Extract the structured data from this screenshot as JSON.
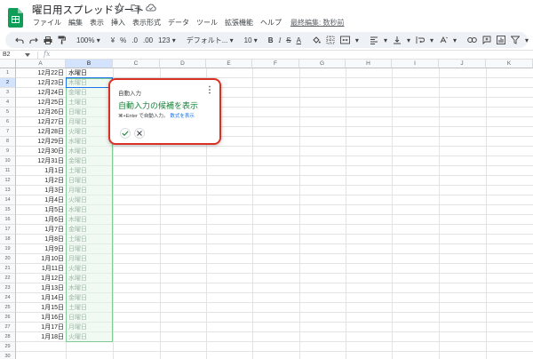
{
  "header": {
    "title": "曜日用スプレッドシート",
    "menus": [
      "ファイル",
      "編集",
      "表示",
      "挿入",
      "表示形式",
      "データ",
      "ツール",
      "拡張機能",
      "ヘルプ"
    ],
    "last_edit": "最終編集: 数秒前"
  },
  "toolbar": {
    "zoom": "100%",
    "currency": "¥",
    "percent": "%",
    "dec_less": ".0",
    "dec_more": ".00",
    "number_format": "123",
    "font": "デフォルト...",
    "font_size": "10",
    "bold": "B",
    "italic": "I",
    "strike": "S",
    "text_color": "A"
  },
  "formula_bar": {
    "cell_ref": "B2",
    "fx": "fx"
  },
  "grid": {
    "columns": [
      "A",
      "B",
      "C",
      "D",
      "E",
      "F",
      "G",
      "H",
      "I",
      "J",
      "K"
    ],
    "row_numbers": [
      "1",
      "2",
      "3",
      "4",
      "5",
      "6",
      "7",
      "8",
      "9",
      "10",
      "11",
      "12",
      "13",
      "14",
      "15",
      "16",
      "17",
      "18",
      "19",
      "20",
      "21",
      "22",
      "23",
      "24",
      "25",
      "26",
      "27",
      "28",
      "29",
      "30"
    ],
    "col_a": [
      "12月22日",
      "12月23日",
      "12月24日",
      "12月25日",
      "12月26日",
      "12月27日",
      "12月28日",
      "12月29日",
      "12月30日",
      "12月31日",
      "1月1日",
      "1月2日",
      "1月3日",
      "1月4日",
      "1月5日",
      "1月6日",
      "1月7日",
      "1月8日",
      "1月9日",
      "1月10日",
      "1月11日",
      "1月12日",
      "1月13日",
      "1月14日",
      "1月15日",
      "1月16日",
      "1月17日",
      "1月18日"
    ],
    "col_b": [
      "水曜日",
      "木曜日",
      "金曜日",
      "土曜日",
      "日曜日",
      "月曜日",
      "火曜日",
      "水曜日",
      "木曜日",
      "金曜日",
      "土曜日",
      "日曜日",
      "月曜日",
      "火曜日",
      "水曜日",
      "木曜日",
      "金曜日",
      "土曜日",
      "日曜日",
      "月曜日",
      "火曜日",
      "水曜日",
      "木曜日",
      "金曜日",
      "土曜日",
      "日曜日",
      "月曜日",
      "火曜日"
    ]
  },
  "autocomplete": {
    "title": "自動入力",
    "suggestion": "自動入力の候補を表示",
    "shortcut": "⌘+Enter で自動入力。",
    "show_formula": "数式を表示"
  },
  "colors": {
    "accent_green": "#188038",
    "highlight_red": "#d93025",
    "selection_blue": "#1a73e8",
    "suggest_text": "#9fb7a6"
  }
}
